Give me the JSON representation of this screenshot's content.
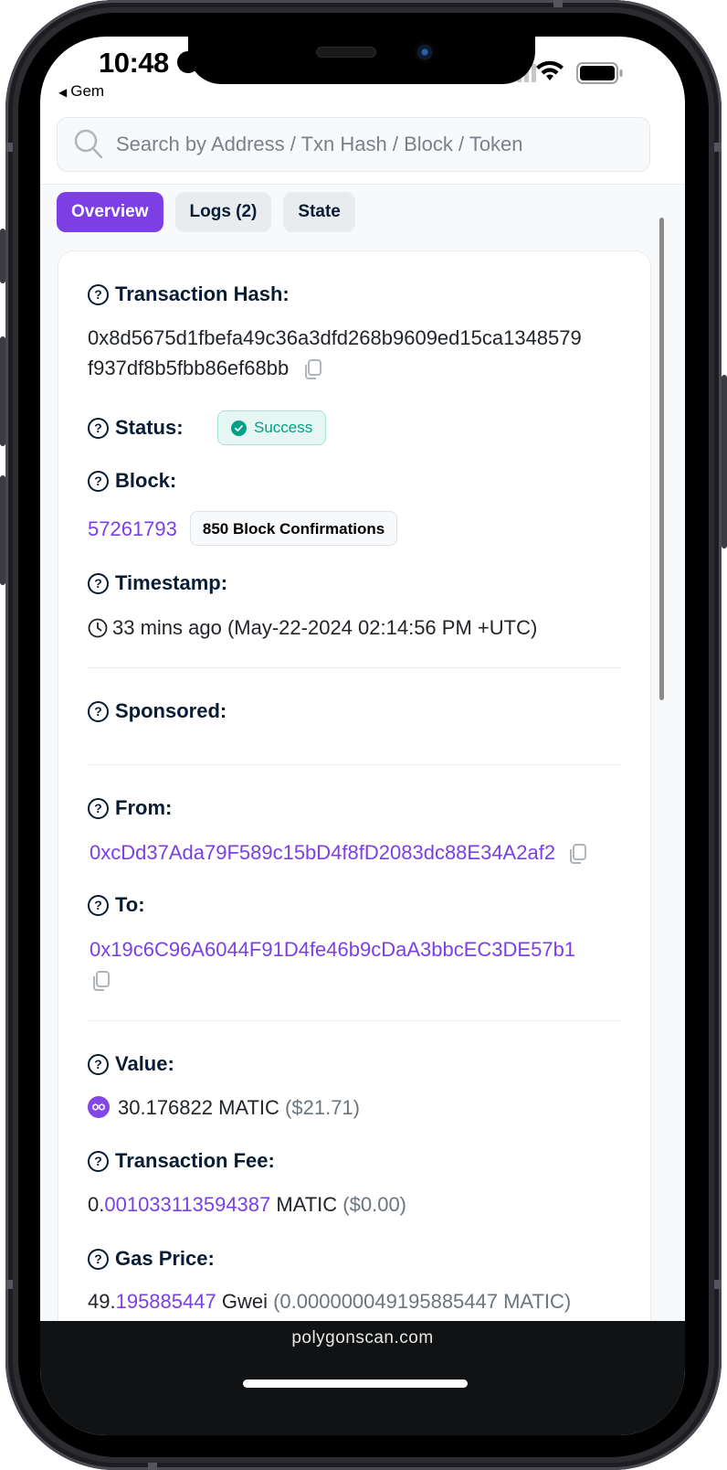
{
  "status_bar": {
    "time": "10:48",
    "back_app": "Gem"
  },
  "search": {
    "placeholder": "Search by Address / Txn Hash / Block / Token"
  },
  "tabs": [
    {
      "label": "Overview",
      "active": true
    },
    {
      "label": "Logs (2)",
      "active": false
    },
    {
      "label": "State",
      "active": false
    }
  ],
  "details": {
    "tx_hash": {
      "label": "Transaction Hash:",
      "value_line1": "0x8d5675d1fbefa49c36a3dfd268b9609ed15ca1348579",
      "value_line2": "f937df8b5fbb86ef68bb"
    },
    "status": {
      "label": "Status:",
      "value": "Success"
    },
    "block": {
      "label": "Block:",
      "number": "57261793",
      "confirmations": "850 Block Confirmations"
    },
    "timestamp": {
      "label": "Timestamp:",
      "value": "33 mins ago (May-22-2024 02:14:56 PM +UTC)"
    },
    "sponsored": {
      "label": "Sponsored:"
    },
    "from": {
      "label": "From:",
      "address": "0xcDd37Ada79F589c15bD4f8fD2083dc88E34A2af2"
    },
    "to": {
      "label": "To:",
      "address": "0x19c6C96A6044F91D4fe46b9cDaA3bbcEC3DE57b1"
    },
    "value": {
      "label": "Value:",
      "amount": "30.176822 MATIC",
      "usd": "($21.71)"
    },
    "tx_fee": {
      "label": "Transaction Fee:",
      "int_part": "0.",
      "dec_part": "001033113594387",
      "unit": " MATIC",
      "usd": " ($0.00)"
    },
    "gas_price": {
      "label": "Gas Price:",
      "int_part": "49.",
      "dec_part": "195885447",
      "unit": " Gwei",
      "matic": " (0.000000049195885447 MATIC)"
    }
  },
  "browser": {
    "url": "polygonscan.com"
  },
  "colors": {
    "accent": "#7b3fe4",
    "success": "#00a186",
    "text_dark": "#081d35",
    "muted": "#6c757d"
  }
}
